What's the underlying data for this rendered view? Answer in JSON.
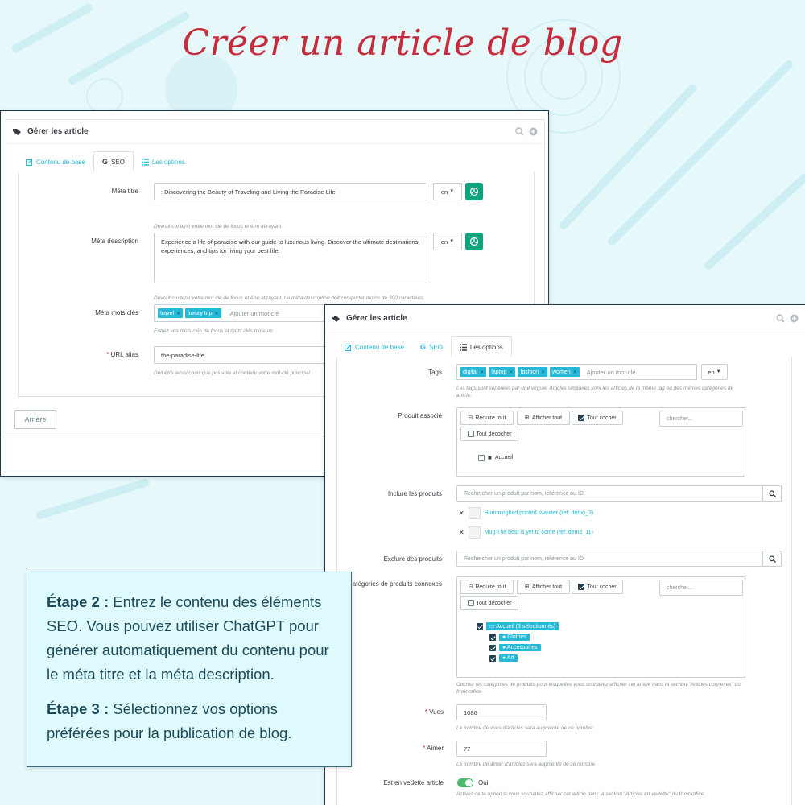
{
  "page_title": "Créer un article de blog",
  "colors": {
    "accent": "#25b9d7",
    "title": "#c62b3b",
    "chatgpt": "#10a37f",
    "toggle_on": "#4cbb6c"
  },
  "panel1": {
    "header": "Gérer les article",
    "tabs": [
      "Contenu de base",
      "SEO",
      "Les options"
    ],
    "meta_title": {
      "label": "Méta titre",
      "value": ": Discovering the Beauty of Traveling and Living the Paradise Life",
      "lang": "en",
      "help": "Devrait contenir votre mot clé de focus et être attrayant."
    },
    "meta_description": {
      "label": "Méta description",
      "value": "Experience a life of paradise with our guide to luxurious living. Discover the ultimate destinations, experiences, and tips for living your best life.",
      "lang": "en",
      "help": "Devrait contenir votre mot clé de focus et être attrayant. La méta description doit comporter moins de 300 caractères."
    },
    "meta_keywords": {
      "label": "Méta mots clés",
      "chips": [
        "travel",
        "luxury trip"
      ],
      "placeholder": "Ajouter un mot-clé",
      "help": "Entrez vos mots clés de focus et mots clés mineurs"
    },
    "url_alias": {
      "label": "URL alias",
      "value": "the-paradise-life",
      "help": "Doit être aussi court que possible et contenir votre mot-clé principal"
    },
    "back_button": "Arrière"
  },
  "panel2": {
    "header": "Gérer les article",
    "tabs": [
      "Contenu de base",
      "SEO",
      "Les options"
    ],
    "tags": {
      "label": "Tags",
      "chips": [
        "digital",
        "laptop",
        "fashion",
        "women"
      ],
      "placeholder": "Ajouter un mot-clé",
      "lang": "en",
      "help": "Les tags sont séparées par une virgule. Articles similaires sont les articles de la même tag ou des mêmes catégories de article."
    },
    "associated_product": {
      "label": "Produit associé",
      "buttons": [
        "Réduire tout",
        "Afficher tout",
        "Tout cocher",
        "Tout décocher"
      ],
      "search_placeholder": "chercher...",
      "tree": [
        "Accueil"
      ]
    },
    "include_products": {
      "label": "Inclure les produits",
      "placeholder": "Rechercher un produit par nom, référence ou ID",
      "items": [
        "Hummingbird printed sweater (ref: demo_3)",
        "Mug The best is yet to come (ref: demo_11)"
      ]
    },
    "exclude_products": {
      "label": "Exclure des produits",
      "placeholder": "Rechercher un produit par nom, référence ou ID"
    },
    "related_categories": {
      "label": "Catégories de produits connexes",
      "buttons": [
        "Réduire tout",
        "Afficher tout",
        "Tout cocher",
        "Tout décocher"
      ],
      "search_placeholder": "chercher...",
      "tree": [
        "Accueil (3 sélectionnés)",
        "Clothes",
        "Accessoires",
        "Art"
      ],
      "help": "Cochez les catégories de produits pour lesquelles vous souhaitez afficher cet article dans la section \"Articles connexes\" du front-office."
    },
    "views": {
      "label": "Vues",
      "value": "1086",
      "help": "Le nombre de vues d'articles sera augmenté de ce nombre"
    },
    "likes": {
      "label": "Aimer",
      "value": "77",
      "help": "Le nombre de aimer d'articles sera augmenté de ce nombre"
    },
    "featured": {
      "label": "Est en vedette article",
      "value": "Oui",
      "enabled": true,
      "help": "Activez cette option si vous souhaitez afficher cet article dans la section \"Articles en vedette\" du front-office."
    }
  },
  "info": {
    "step2_label": "Étape 2 :",
    "step2_text": "Entrez le contenu des éléments SEO. Vous pouvez utiliser ChatGPT pour générer automatiquement du contenu pour le méta titre et la méta description.",
    "step3_label": "Étape 3 :",
    "step3_text": "Sélectionnez vos options préférées pour la publication de blog."
  }
}
